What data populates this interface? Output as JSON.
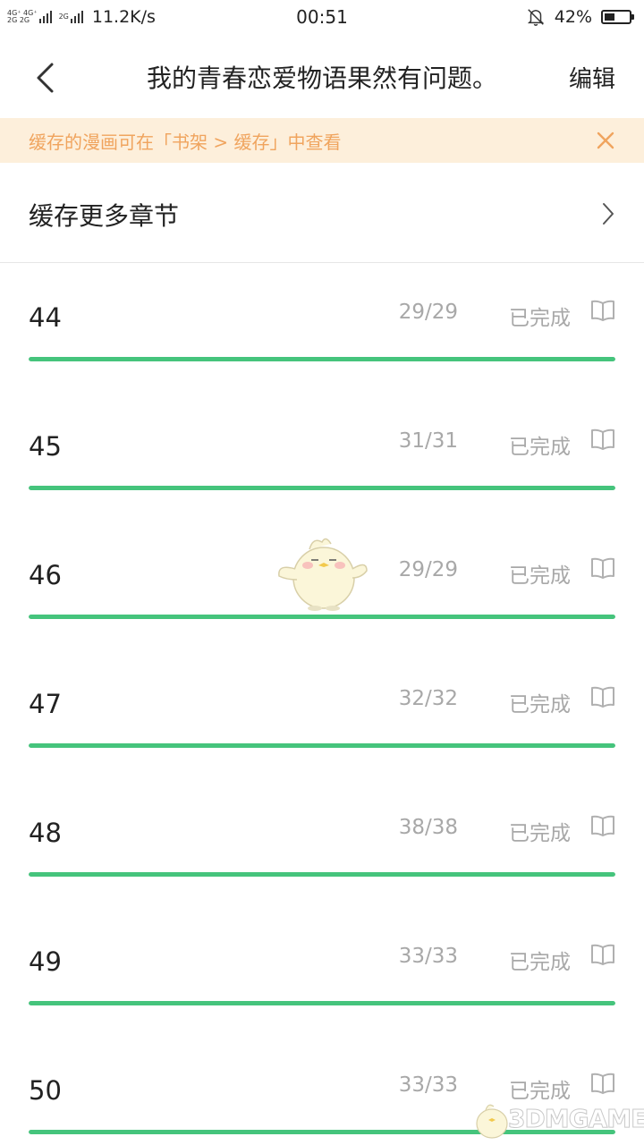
{
  "status_bar": {
    "net_top": "4G⁺ 4G⁺",
    "net_bottom": "2G 2G",
    "net_third": "2G",
    "speed": "11.2K/s",
    "time": "00:51",
    "battery_pct": "42%",
    "battery_level": 0.42
  },
  "header": {
    "back_icon": "chevron-left-icon",
    "title": "我的青春恋爱物语果然有问题。",
    "edit_label": "编辑"
  },
  "notice": {
    "text": "缓存的漫画可在「书架 > 缓存」中查看",
    "close_icon": "close-icon",
    "bg_color": "#fdefdb",
    "text_color": "#f0a45e"
  },
  "cache_more": {
    "label": "缓存更多章节",
    "arrow_icon": "chevron-right-icon"
  },
  "chapters": [
    {
      "num": "44",
      "pages": "29/29",
      "status": "已完成",
      "progress": 1.0
    },
    {
      "num": "45",
      "pages": "31/31",
      "status": "已完成",
      "progress": 1.0
    },
    {
      "num": "46",
      "pages": "29/29",
      "status": "已完成",
      "progress": 1.0
    },
    {
      "num": "47",
      "pages": "32/32",
      "status": "已完成",
      "progress": 1.0
    },
    {
      "num": "48",
      "pages": "38/38",
      "status": "已完成",
      "progress": 1.0
    },
    {
      "num": "49",
      "pages": "33/33",
      "status": "已完成",
      "progress": 1.0
    },
    {
      "num": "50",
      "pages": "33/33",
      "status": "已完成",
      "progress": 1.0
    }
  ],
  "colors": {
    "progress": "#45c47c",
    "muted_text": "#a8a8a8"
  },
  "watermark": {
    "text": "3DMGAME"
  }
}
